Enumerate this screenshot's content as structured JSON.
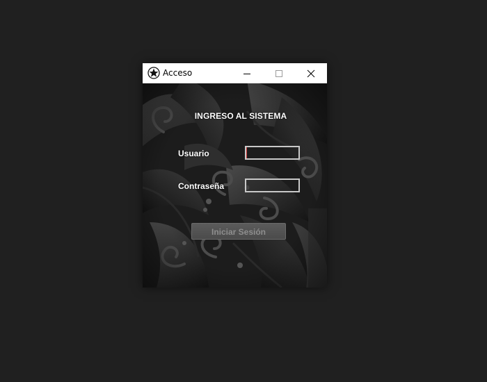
{
  "window": {
    "title": "Acceso",
    "app_icon": "star-badge-icon",
    "controls": {
      "minimize_icon": "minimize-icon",
      "maximize_icon": "maximize-icon",
      "close_icon": "close-icon"
    }
  },
  "form": {
    "heading": "INGRESO AL SISTEMA",
    "username_label": "Usuario",
    "username_value": "",
    "password_label": "Contraseña",
    "password_value": "",
    "submit_label": "Iniciar Sesión"
  },
  "colors": {
    "desktop": "#202020",
    "titlebar": "#ffffff",
    "field_border": "#c9c9c9",
    "focus_caret": "#d23a3a",
    "button_bg": "#555555",
    "button_text": "#8e8e8e"
  }
}
